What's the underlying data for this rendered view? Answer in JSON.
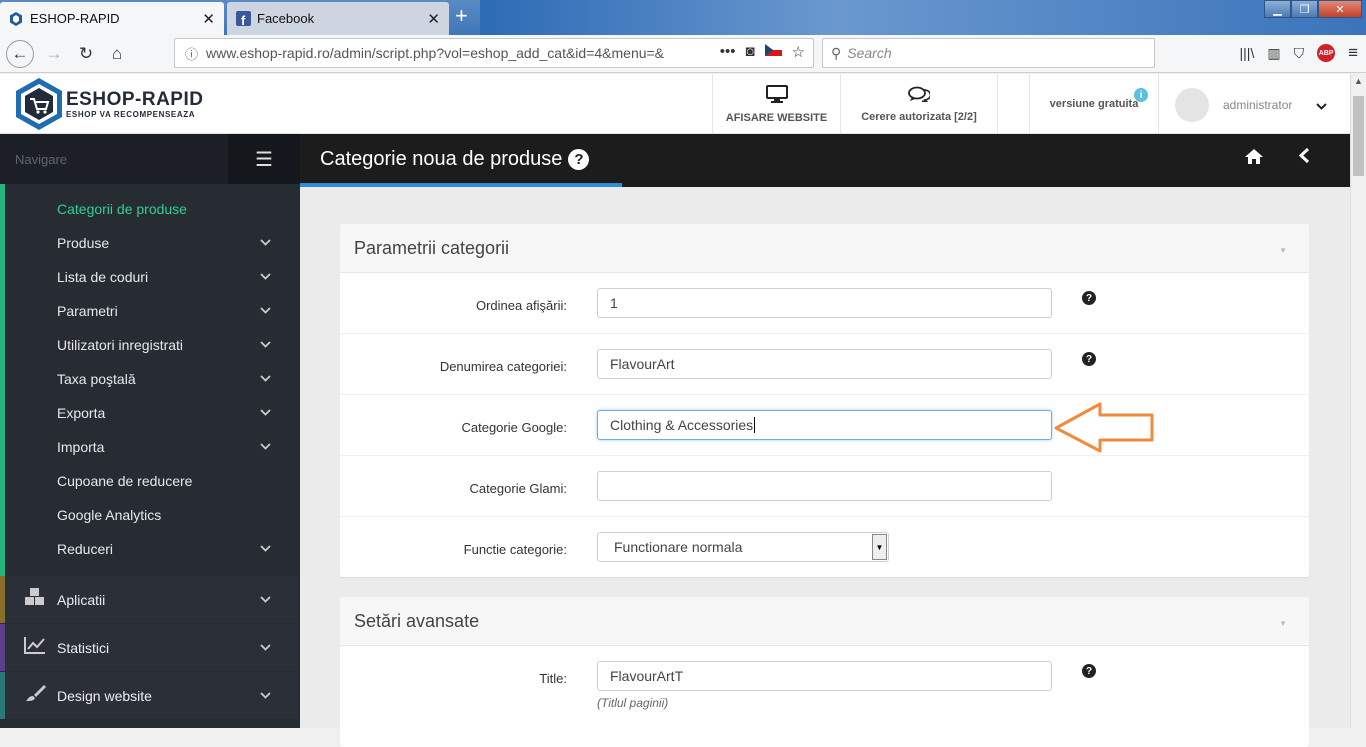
{
  "browser": {
    "tabs": [
      {
        "title": "ESHOP-RAPID",
        "active": true
      },
      {
        "title": "Facebook",
        "active": false
      }
    ],
    "url": "www.eshop-rapid.ro/admin/script.php?vol=eshop_add_cat&id=4&menu=&",
    "search_placeholder": "Search",
    "abp_label": "ABP"
  },
  "header": {
    "brand": "ESHOP-RAPID",
    "tagline": "ESHOP VA RECOMPENSEAZA",
    "buttons": {
      "website": "AFISARE WEBSITE",
      "requests": "Cerere autorizata [2/2]",
      "version": "versiune gratuita"
    },
    "user": "administrator"
  },
  "sidebar": {
    "nav_label": "Navigare",
    "subitems": [
      {
        "label": "Categorii de produse",
        "active": true,
        "expandable": false
      },
      {
        "label": "Produse",
        "expandable": true
      },
      {
        "label": "Lista de coduri",
        "expandable": true
      },
      {
        "label": "Parametri",
        "expandable": true
      },
      {
        "label": "Utilizatori inregistrati",
        "expandable": true
      },
      {
        "label": "Taxa poştală",
        "expandable": true
      },
      {
        "label": "Exporta",
        "expandable": true
      },
      {
        "label": "Importa",
        "expandable": true
      },
      {
        "label": "Cupoane de reducere",
        "expandable": false
      },
      {
        "label": "Google Analytics",
        "expandable": false
      },
      {
        "label": "Reduceri",
        "expandable": true
      }
    ],
    "sections": [
      {
        "label": "Aplicatii",
        "icon": "cubes-icon",
        "color": "#8a6d2a"
      },
      {
        "label": "Statistici",
        "icon": "chart-icon",
        "color": "#5b3f8a"
      },
      {
        "label": "Design website",
        "icon": "brush-icon",
        "color": "#2a7a7a"
      }
    ]
  },
  "page": {
    "title": "Categorie noua de produse"
  },
  "panel1": {
    "title": "Parametrii categorii",
    "fields": {
      "order_label": "Ordinea afişării:",
      "order_value": "1",
      "name_label": "Denumirea categoriei:",
      "name_value": "FlavourArt",
      "google_label": "Categorie Google:",
      "google_value": "Clothing & Accessories",
      "glami_label": "Categorie Glami:",
      "glami_value": "",
      "function_label": "Functie categorie:",
      "function_value": "Functionare normala"
    }
  },
  "panel2": {
    "title": "Setări avansate",
    "fields": {
      "title_label": "Title:",
      "title_value": "FlavourArtT",
      "title_hint": "(Titlul paginii)"
    }
  },
  "colors": {
    "accent_green": "#30d090",
    "accent_blue": "#2a8fd8",
    "arrow_orange": "#f08a3c"
  }
}
